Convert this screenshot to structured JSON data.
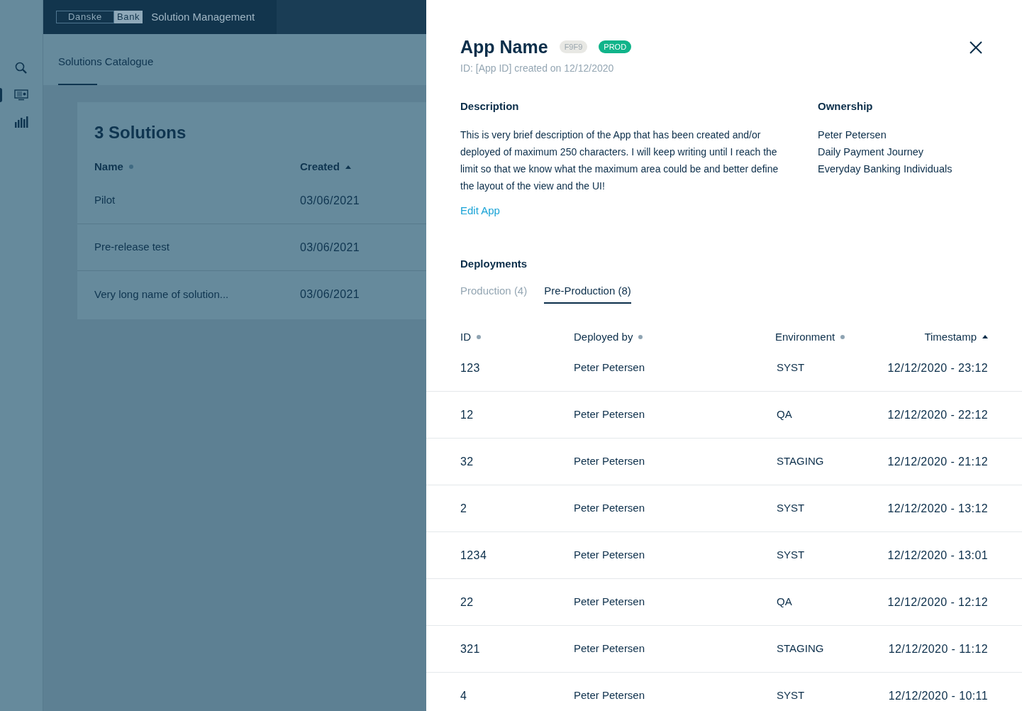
{
  "header": {
    "logo_left": "Danske",
    "logo_right": "Bank",
    "title": "Solution Management"
  },
  "rail": [
    {
      "kind": "search",
      "selected": false
    },
    {
      "kind": "monitor",
      "selected": true
    },
    {
      "kind": "chart",
      "selected": false
    }
  ],
  "subnav": [
    {
      "label": "Solutions Catalogue",
      "selected": true
    }
  ],
  "catalogue": {
    "title": "3 Solutions",
    "columns": [
      {
        "label": "Name",
        "sorted": false
      },
      {
        "label": "Created",
        "sorted": true
      }
    ],
    "rows": [
      {
        "name": "Pilot",
        "created": "03/06/2021"
      },
      {
        "name": "Pre-release test",
        "created": "03/06/2021"
      },
      {
        "name": "Very long name of solution...",
        "created": "03/06/2021"
      }
    ]
  },
  "detail": {
    "title": "App Name",
    "badges": [
      {
        "label": "F9F9",
        "kind": "code"
      },
      {
        "label": "PROD",
        "kind": "env"
      }
    ],
    "subtitle": "ID: [App ID] created on 12/12/2020",
    "description": {
      "heading": "Description",
      "text": "This is very brief description of the App that has been created and/or deployed of maximum 250 characters. I will keep writing until I reach the limit so that we know what the maximum area could be and better define the layout of the view and the UI!",
      "link": "Edit App"
    },
    "ownership": {
      "heading": "Ownership",
      "lines": [
        "Peter Petersen",
        "Daily Payment Journey",
        "Everyday Banking Individuals"
      ]
    },
    "deployments": {
      "heading": "Deployments",
      "tabs": [
        {
          "label": "Production (4)",
          "selected": false
        },
        {
          "label": "Pre-Production (8)",
          "selected": true
        }
      ],
      "columns": [
        {
          "label": "ID",
          "sorted": false
        },
        {
          "label": "Deployed by",
          "sorted": false
        },
        {
          "label": "Environment",
          "sorted": false
        },
        {
          "label": "Timestamp",
          "sorted": true
        }
      ],
      "rows": [
        {
          "id": "123",
          "by": "Peter Petersen",
          "env": "SYST",
          "time": "12/12/2020 - 23:12"
        },
        {
          "id": "12",
          "by": "Peter Petersen",
          "env": "QA",
          "time": "12/12/2020 - 22:12"
        },
        {
          "id": "32",
          "by": "Peter Petersen",
          "env": "STAGING",
          "time": "12/12/2020 - 21:12"
        },
        {
          "id": "2",
          "by": "Peter Petersen",
          "env": "SYST",
          "time": "12/12/2020 - 13:12"
        },
        {
          "id": "1234",
          "by": "Peter Petersen",
          "env": "SYST",
          "time": "12/12/2020 - 13:01"
        },
        {
          "id": "22",
          "by": "Peter Petersen",
          "env": "QA",
          "time": "12/12/2020 - 12:12"
        },
        {
          "id": "321",
          "by": "Peter Petersen",
          "env": "STAGING",
          "time": "12/12/2020 - 11:12"
        },
        {
          "id": "4",
          "by": "Peter Petersen",
          "env": "SYST",
          "time": "12/12/2020 - 10:11"
        }
      ]
    }
  }
}
